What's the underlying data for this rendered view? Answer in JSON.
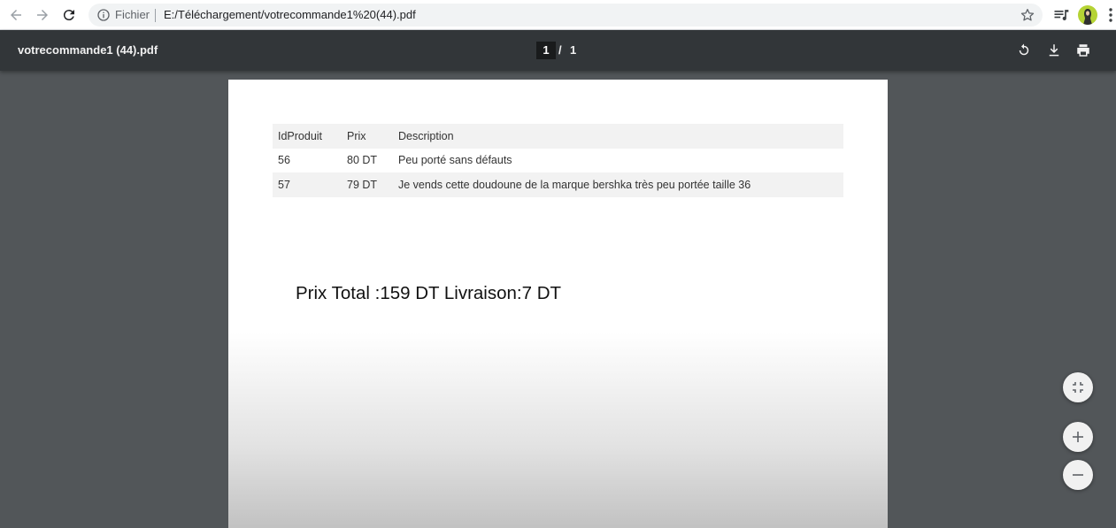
{
  "browser": {
    "scheme_label": "Fichier",
    "url": "E:/Téléchargement/votrecommande1%20(44).pdf"
  },
  "viewer": {
    "file_title": "votrecommande1 (44).pdf",
    "current_page": "1",
    "page_separator": "/",
    "total_pages": "1"
  },
  "document": {
    "table": {
      "headers": [
        "IdProduit",
        "Prix",
        "Description"
      ],
      "rows": [
        [
          "56",
          "80 DT",
          "Peu porté sans défauts"
        ],
        [
          "57",
          "79 DT",
          "Je vends cette doudoune de la marque bershka très peu portée taille 36"
        ]
      ]
    },
    "total_line": "Prix Total :159 DT Livraison:7 DT"
  },
  "icons": {
    "back": "arrow-back-icon",
    "forward": "arrow-forward-icon",
    "reload": "reload-icon",
    "info": "info-icon",
    "bookmark": "star-icon",
    "media": "media-queue-icon",
    "menu": "kebab-menu-icon",
    "rotate": "rotate-icon",
    "download": "download-icon",
    "print": "print-icon",
    "fit": "fit-to-page-icon",
    "zoom_in": "plus-icon",
    "zoom_out": "minus-icon"
  }
}
